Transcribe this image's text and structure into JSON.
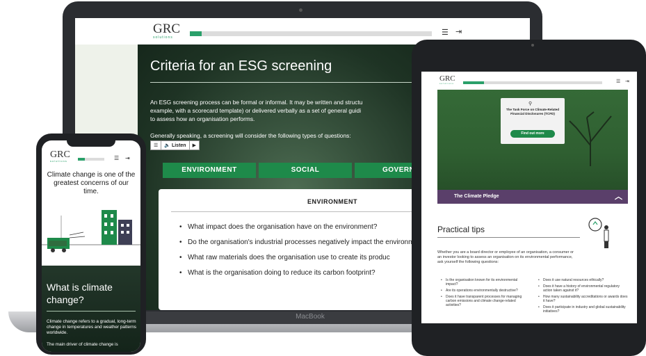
{
  "laptop": {
    "brand": "MacBook",
    "logo": {
      "main": "GRC",
      "sub": "solutions"
    },
    "progress_fraction": 0.05,
    "title": "Criteria for an ESG screening",
    "paragraph": "An ESG screening process can be formal or informal. It may be written and structured (for example, with a scorecard template) or delivered verbally as a set of general guiding questions to assess how an organisation performs.",
    "paragraph_visible_lines": [
      "An ESG screening process can be formal or informal. It may be written and structu",
      "example, with a scorecard template) or delivered verbally as a set of general guidi",
      "to assess how an organisation performs."
    ],
    "paragraph2": "Generally speaking, a screening will consider the following types of questions:",
    "listen_label": "Listen",
    "tabs": [
      "ENVIRONMENT",
      "SOCIAL",
      "GOVERNA"
    ],
    "card": {
      "title": "ENVIRONMENT",
      "items": [
        "What impact does the organisation have on the environment?",
        "Do the organisation's industrial processes negatively impact the environment and local communities?",
        "What raw materials does the organisation use to create its produc",
        "What is the organisation doing to reduce its carbon footprint?"
      ]
    }
  },
  "tablet": {
    "logo": {
      "main": "GRC",
      "sub": "solutions"
    },
    "progress_fraction": 0.15,
    "card_text": "The Task Force on Climate-Related Financial Disclosures (TCFD)",
    "card_button": "Find out more",
    "pledge_label": "The Climate Pledge",
    "tips_title": "Practical tips",
    "tips_paragraph": "Whether you are a board director or employee of an organisation, a consumer or an investor looking to assess an organisation on its environmental performance, ask yourself the following questions:",
    "left_list": [
      "Is the organisation known for its environmental impact?",
      "Are its operations environmentally destructive?",
      "Does it have transparent processes for managing carbon emissions and climate change-related activities?"
    ],
    "right_list": [
      "Does it use natural resources ethically?",
      "Does it have a history of environmental regulatory action taken against it?",
      "How many sustainability accreditations or awards does it have?",
      "Does it participate in industry and global sustainability initiatives?"
    ]
  },
  "phone": {
    "logo": {
      "main": "GRC",
      "sub": "solutions"
    },
    "progress_fraction": 0.25,
    "heading": "Climate change is one of the greatest concerns of our time.",
    "title": "What is climate change?",
    "paragraph": "Climate change refers to a gradual, long-term change in temperatures and weather patterns worldwide.",
    "paragraph2": "The main driver of climate change is"
  },
  "colors": {
    "accent": "#1e8a4a",
    "progress": "#2aa06a",
    "pledge": "#5a3f6a",
    "dark_green": "#1e3324"
  }
}
